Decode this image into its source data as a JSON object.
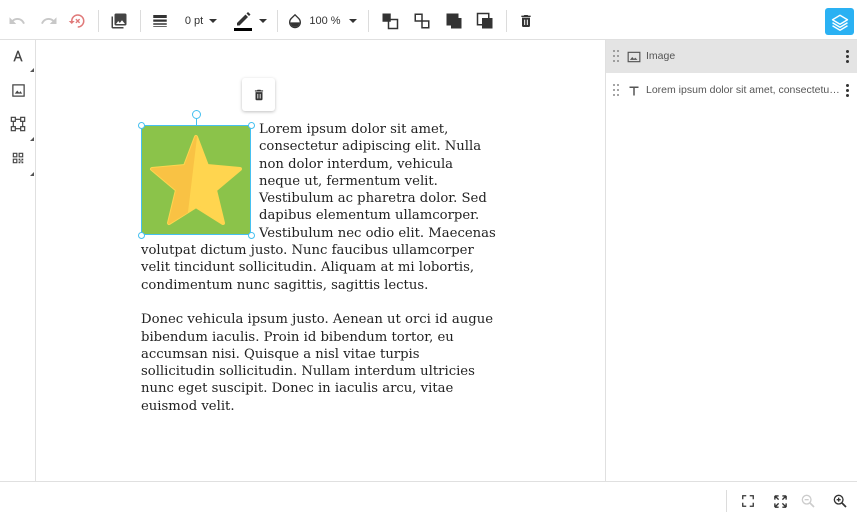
{
  "toolbar": {
    "icons": [
      "undo-icon",
      "redo-icon",
      "reset-icon",
      "image-library-icon",
      "line-weight-icon",
      "stroke-color-icon",
      "opacity-icon",
      "bring-forward-icon",
      "send-backward-icon",
      "bring-to-front-icon",
      "send-to-back-icon",
      "delete-icon"
    ],
    "stroke_width": "0 pt",
    "opacity": "100 %",
    "stroke_color": "#000000",
    "accent_color": "#2ab1f3"
  },
  "left_tools": [
    "text-tool-icon",
    "image-tool-icon",
    "shape-tool-icon",
    "qr-code-tool-icon"
  ],
  "canvas": {
    "image_fill": "#8bc34a",
    "paragraphs": [
      "Lorem ipsum dolor sit amet, consectetur adipiscing elit. Nulla non dolor interdum, vehicula neque ut, fermentum velit. Vestibulum ac pharetra dolor. Sed dapibus elementum ullamcorper. Vestibulum nec odio elit. Maecenas volutpat dictum justo. Nunc faucibus ullamcorper velit tincidunt sollicitudin. Aliquam at mi lobortis, condimentum nunc sagittis, sagittis lectus.",
      "Donec vehicula ipsum justo. Aenean ut orci id augue bibendum iaculis. Proin id bibendum tortor, eu accumsan nisi. Quisque a nisl vitae turpis sollicitudin sollicitudin. Nullam interdum ultricies nunc eget suscipit. Donec in iaculis arcu, vitae euismod velit."
    ]
  },
  "layers": [
    {
      "label": "Image",
      "icon": "image-icon",
      "selected": true
    },
    {
      "label": "Lorem ipsum dolor sit amet, consectetur adipiscing elit.",
      "icon": "text-icon",
      "selected": false
    }
  ],
  "bottom_bar": [
    "fit-screen-icon",
    "fullscreen-icon",
    "zoom-out-icon",
    "zoom-in-icon"
  ]
}
